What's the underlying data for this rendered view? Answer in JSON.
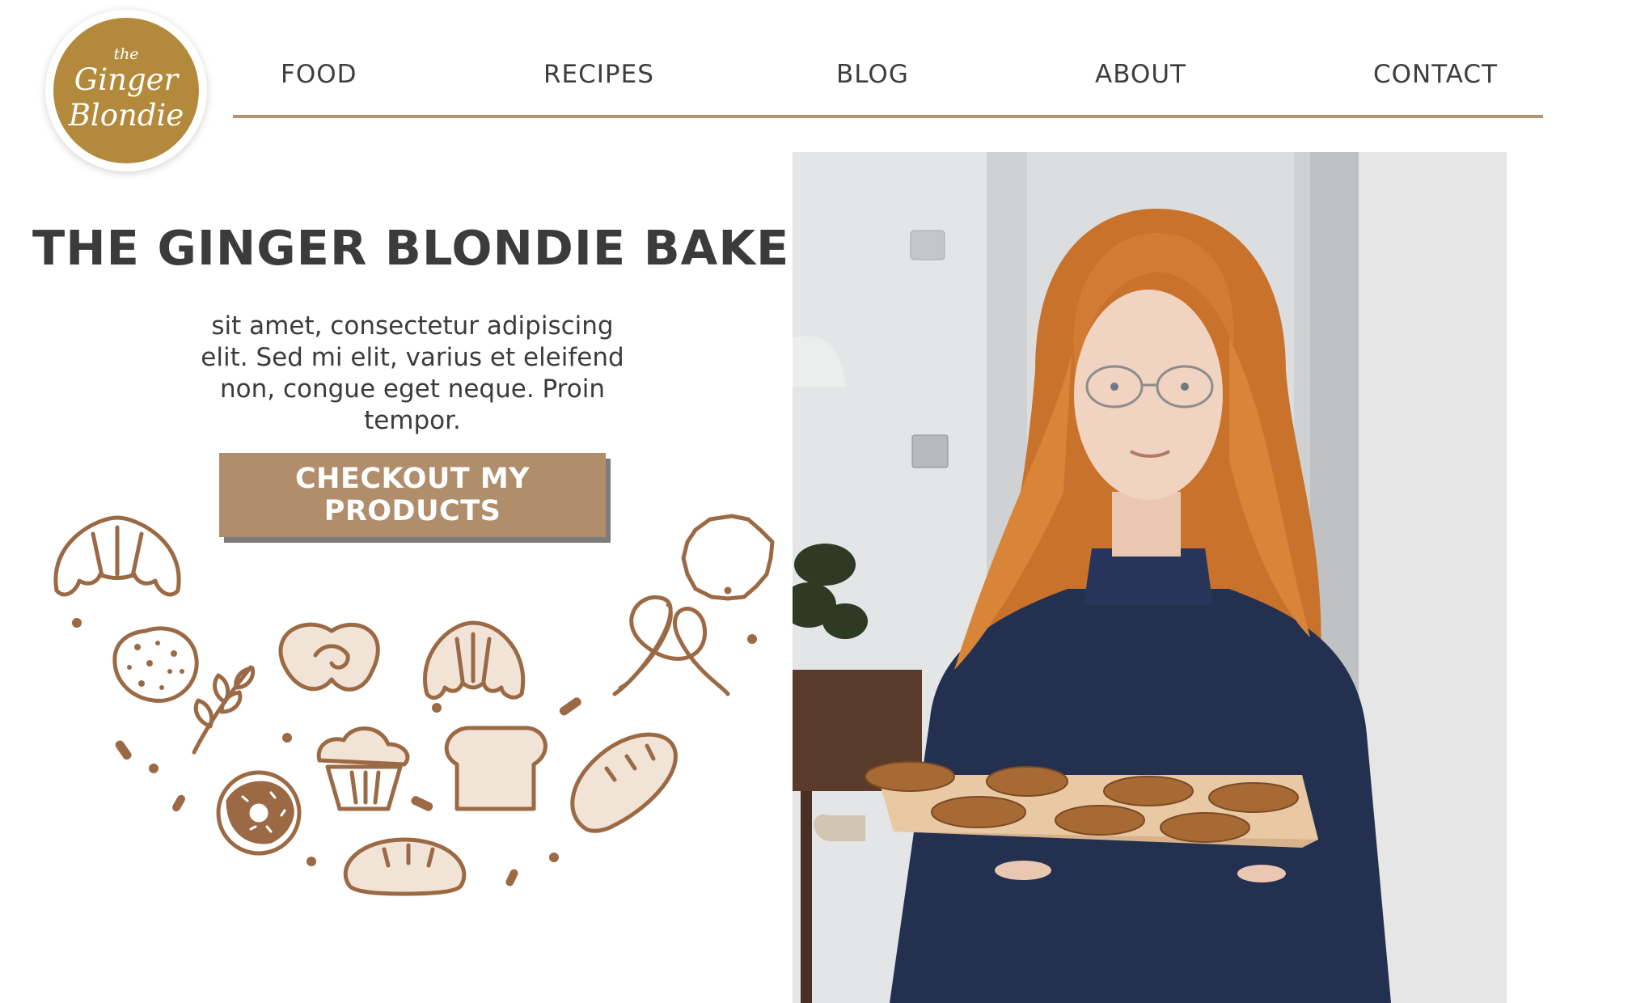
{
  "logo": {
    "small": "the",
    "line1": "Ginger",
    "line2": "Blondie"
  },
  "nav": {
    "items": [
      "FOOD",
      "RECIPES",
      "BLOG",
      "ABOUT",
      "CONTACT"
    ]
  },
  "hero": {
    "title": "THE GINGER BLONDIE BAKERY",
    "body": "sit amet, consectetur adipiscing elit. Sed mi elit, varius et eleifend non, congue eget neque. Proin tempor.",
    "cta_label": "CHECKOUT MY PRODUCTS"
  },
  "colors": {
    "accent": "#b08e6b",
    "logo": "#b38a3c",
    "text": "#3b3b3b",
    "doodle_stroke": "#9b6a45",
    "doodle_fill": "#f1e3d6"
  },
  "icons": [
    "croissant-icon",
    "cookie-icon",
    "wheat-icon",
    "pretzel-icon",
    "muffin-icon",
    "bread-loaf-icon",
    "donut-icon",
    "baguette-icon",
    "bun-icon",
    "tart-icon"
  ]
}
